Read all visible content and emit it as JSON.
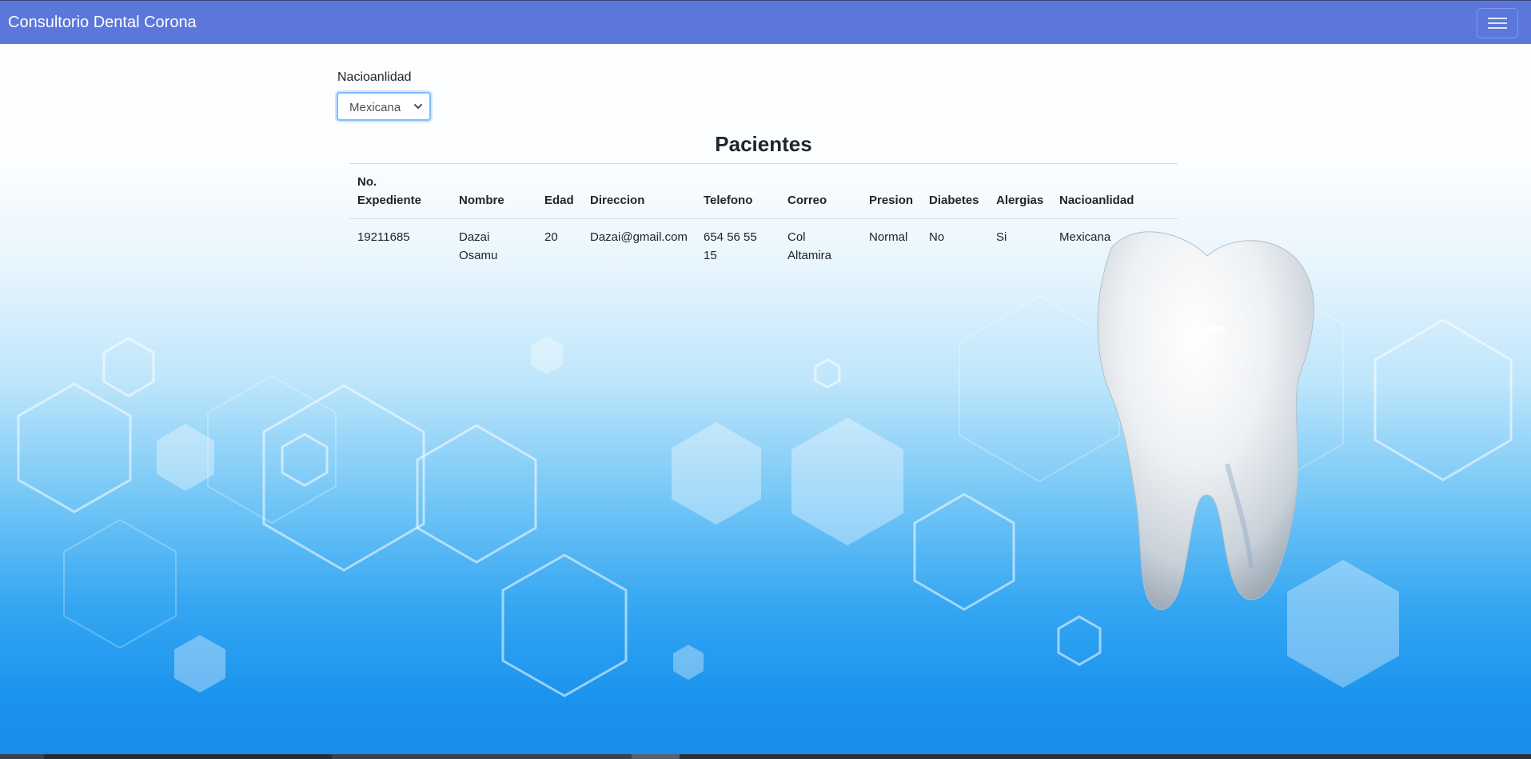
{
  "app": {
    "title": "Consultorio Dental Corona",
    "menu_icon": "hamburger-icon"
  },
  "filter": {
    "label": "Nacioanlidad",
    "selected": "Mexicana"
  },
  "patients": {
    "title": "Pacientes",
    "columns": [
      "No. Expediente",
      "Nombre",
      "Edad",
      "Direccion",
      "Telefono",
      "Correo",
      "Presion",
      "Diabetes",
      "Alergias",
      "Nacioanlidad"
    ],
    "columns_lines": [
      [
        "No.",
        "Expediente"
      ],
      [
        "Nombre"
      ],
      [
        "Edad"
      ],
      [
        "Direccion"
      ],
      [
        "Telefono"
      ],
      [
        "Correo"
      ],
      [
        "Presion"
      ],
      [
        "Diabetes"
      ],
      [
        "Alergias"
      ],
      [
        "Nacioanlidad"
      ]
    ],
    "rows": [
      {
        "cells": [
          "19211685",
          "Dazai Osamu",
          "20",
          "Dazai@gmail.com",
          "654 56 55 15",
          "Col Altamira",
          "Normal",
          "No",
          "Si",
          "Mexicana"
        ],
        "cells_lines": [
          [
            "19211685"
          ],
          [
            "Dazai",
            "Osamu"
          ],
          [
            "20"
          ],
          [
            "Dazai@gmail.com"
          ],
          [
            "654 56 55",
            "15"
          ],
          [
            "Col",
            "Altamira"
          ],
          [
            "Normal"
          ],
          [
            "No"
          ],
          [
            "Si"
          ],
          [
            "Mexicana"
          ]
        ]
      }
    ]
  },
  "colors": {
    "navbar": "#5b77db",
    "focus_border": "#80bdff",
    "background_bottom": "#1a8ce9"
  }
}
